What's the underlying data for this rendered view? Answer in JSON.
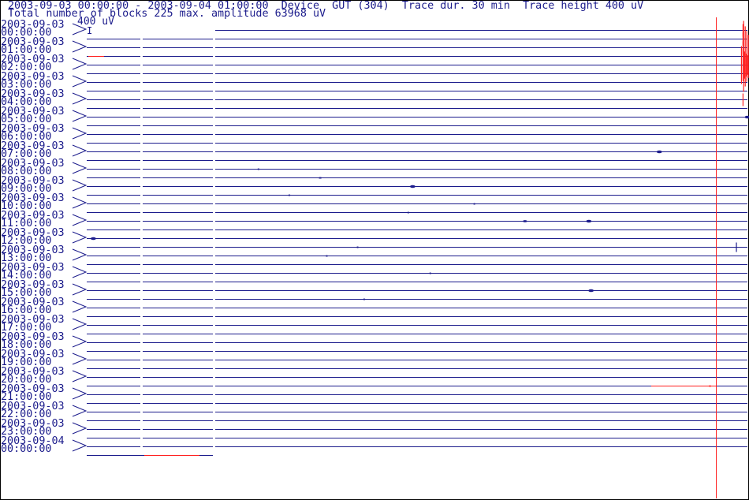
{
  "header": {
    "line1": "2003-09-03 00:00:00 - 2003-09-04 01:00:00  Device  GUT (304)  Trace dur. 30 min  Trace height 400 uV",
    "line2": "Total number of blocks 225 max. amplitude 63968 uV"
  },
  "scale": {
    "label": "400 uV",
    "marker": "I"
  },
  "colors": {
    "trace": "#1c1c8c",
    "highlight": "#ff2020",
    "axis": "#000000"
  },
  "chart_data": {
    "type": "line",
    "title": "2003-09-03 00:00:00 - 2003-09-04 01:00:00  Device  GUT (304)  Trace dur. 30 min  Trace height 400 uV",
    "subtitle": "Total number of blocks 225 max. amplitude 63968 uV",
    "trace_duration_min": 30,
    "trace_height_uV": 400,
    "max_amplitude_uV": 63968,
    "total_blocks": 225,
    "device": "GUT (304)",
    "start": "2003-09-03 00:00:00",
    "end": "2003-09-04 01:00:00",
    "row_labels": [
      {
        "date": "2003-09-03",
        "time": "00:00:00"
      },
      {
        "date": "2003-09-03",
        "time": "01:00:00"
      },
      {
        "date": "2003-09-03",
        "time": "02:00:00"
      },
      {
        "date": "2003-09-03",
        "time": "03:00:00"
      },
      {
        "date": "2003-09-03",
        "time": "04:00:00"
      },
      {
        "date": "2003-09-03",
        "time": "05:00:00"
      },
      {
        "date": "2003-09-03",
        "time": "06:00:00"
      },
      {
        "date": "2003-09-03",
        "time": "07:00:00"
      },
      {
        "date": "2003-09-03",
        "time": "08:00:00"
      },
      {
        "date": "2003-09-03",
        "time": "09:00:00"
      },
      {
        "date": "2003-09-03",
        "time": "10:00:00"
      },
      {
        "date": "2003-09-03",
        "time": "11:00:00"
      },
      {
        "date": "2003-09-03",
        "time": "12:00:00"
      },
      {
        "date": "2003-09-03",
        "time": "13:00:00"
      },
      {
        "date": "2003-09-03",
        "time": "14:00:00"
      },
      {
        "date": "2003-09-03",
        "time": "15:00:00"
      },
      {
        "date": "2003-09-03",
        "time": "16:00:00"
      },
      {
        "date": "2003-09-03",
        "time": "17:00:00"
      },
      {
        "date": "2003-09-03",
        "time": "18:00:00"
      },
      {
        "date": "2003-09-03",
        "time": "19:00:00"
      },
      {
        "date": "2003-09-03",
        "time": "20:00:00"
      },
      {
        "date": "2003-09-03",
        "time": "21:00:00"
      },
      {
        "date": "2003-09-03",
        "time": "22:00:00"
      },
      {
        "date": "2003-09-03",
        "time": "23:00:00"
      },
      {
        "date": "2003-09-04",
        "time": "00:00:00"
      }
    ],
    "traces_count": 50,
    "events": [
      {
        "trace": 0,
        "minute": 29.8,
        "amp": -0.2,
        "red": true
      },
      {
        "trace": 1,
        "minute": 29.8,
        "amp": -0.2,
        "red": true
      },
      {
        "trace": 2,
        "minute": 29.8,
        "amp": -0.2,
        "red": true
      },
      {
        "trace": 3,
        "minute": 29.9,
        "amp": 1.5,
        "red": true
      },
      {
        "trace": 4,
        "minute": 29.8,
        "amp": 0.8,
        "red": true
      },
      {
        "trace": 8,
        "minute": 29.8,
        "amp": 0.2,
        "red": true
      },
      {
        "trace": 10,
        "minute": 30.0,
        "amp": 0.05
      },
      {
        "trace": 14,
        "minute": 26.0,
        "amp": 0.05
      },
      {
        "trace": 16,
        "minute": 7.8,
        "amp": 0.02
      },
      {
        "trace": 17,
        "minute": 10.6,
        "amp": 0.03
      },
      {
        "trace": 18,
        "minute": 14.8,
        "amp": 0.05
      },
      {
        "trace": 19,
        "minute": 9.2,
        "amp": 0.02
      },
      {
        "trace": 20,
        "minute": 17.6,
        "amp": 0.02
      },
      {
        "trace": 21,
        "minute": 14.6,
        "amp": 0.02
      },
      {
        "trace": 22,
        "minute": 19.9,
        "amp": 0.04
      },
      {
        "trace": 22,
        "minute": 22.8,
        "amp": 0.05
      },
      {
        "trace": 24,
        "minute": 0.3,
        "amp": 0.05
      },
      {
        "trace": 25,
        "minute": 12.3,
        "amp": 0.02
      },
      {
        "trace": 25,
        "minute": 29.5,
        "amp": 0.15
      },
      {
        "trace": 26,
        "minute": 10.9,
        "amp": 0.02
      },
      {
        "trace": 28,
        "minute": 15.6,
        "amp": 0.02
      },
      {
        "trace": 30,
        "minute": 22.9,
        "amp": 0.05
      },
      {
        "trace": 31,
        "minute": 12.6,
        "amp": 0.02
      },
      {
        "trace": 41,
        "minute": 28.3,
        "amp": 0.02,
        "red": true
      }
    ]
  }
}
